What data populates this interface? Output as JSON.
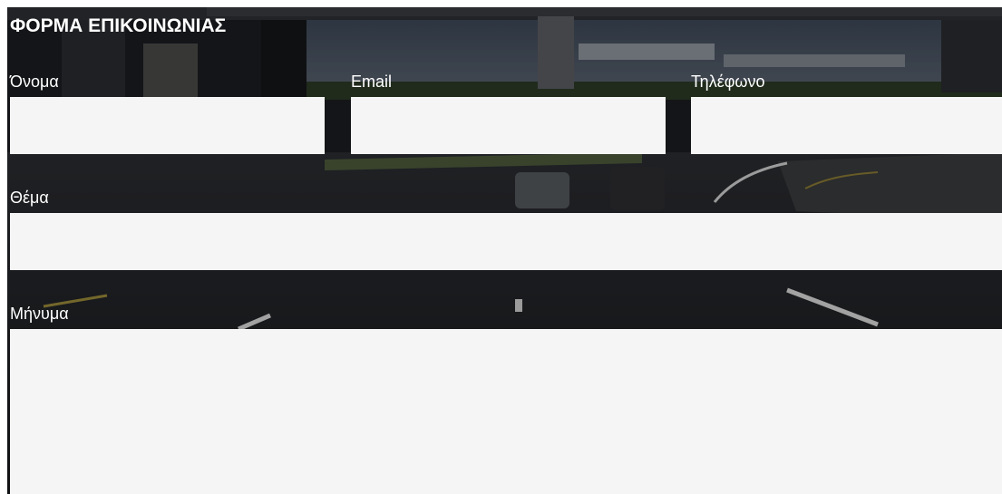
{
  "form": {
    "title": "ΦΟΡΜΑ ΕΠΙΚΟΙΝΩΝΙΑΣ",
    "name_label": "Όνομα",
    "email_label": "Email",
    "phone_label": "Τηλέφωνο",
    "subject_label": "Θέμα",
    "message_label": "Μήνυμα",
    "name_value": "",
    "email_value": "",
    "phone_value": "",
    "subject_value": "",
    "message_value": ""
  },
  "colors": {
    "field_background": "#f5f5f5",
    "label_text": "#ffffff",
    "background_tint": "#1c1e22"
  }
}
